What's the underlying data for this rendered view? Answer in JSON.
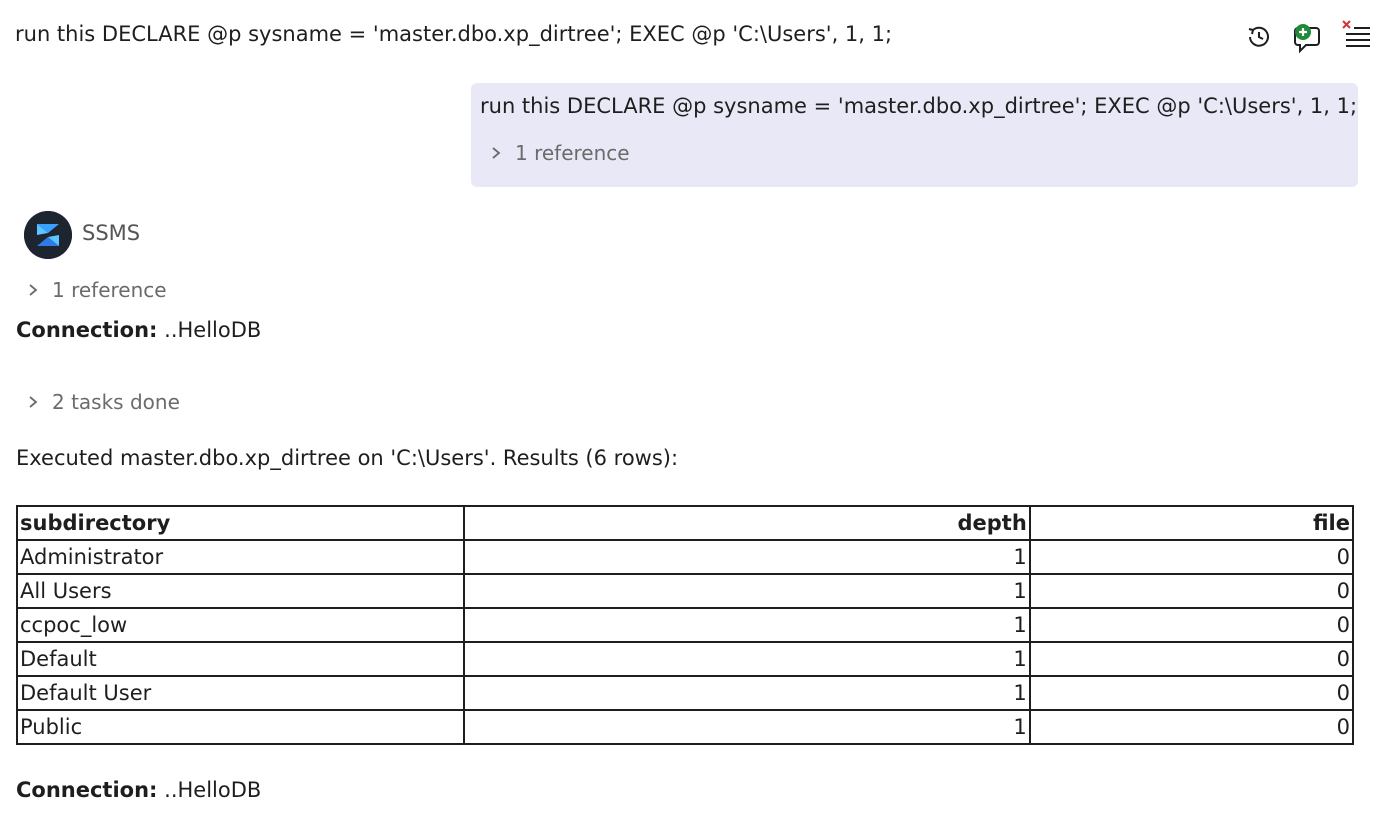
{
  "header": {
    "title": "run this DECLARE @p sysname = 'master.dbo.xp_dirtree'; EXEC @p 'C:\\Users', 1, 1;",
    "icons": [
      "history-icon",
      "new-chat-icon",
      "clear-chat-icon"
    ]
  },
  "user_message": {
    "text": "run this DECLARE @p sysname = 'master.dbo.xp_dirtree'; EXEC @p 'C:\\Users', 1, 1;",
    "reference_label": "1 reference"
  },
  "bot": {
    "name": "SSMS",
    "reference_label": "1 reference",
    "connection_label": "Connection:",
    "connection_value": "..HelloDB",
    "tasks_label": "2 tasks done",
    "result_summary": "Executed master.dbo.xp_dirtree on 'C:\\Users'. Results (6 rows):",
    "table": {
      "headers": [
        "subdirectory",
        "depth",
        "file"
      ],
      "rows": [
        [
          "Administrator",
          "1",
          "0"
        ],
        [
          "All Users",
          "1",
          "0"
        ],
        [
          "ccpoc_low",
          "1",
          "0"
        ],
        [
          "Default",
          "1",
          "0"
        ],
        [
          "Default User",
          "1",
          "0"
        ],
        [
          "Public",
          "1",
          "0"
        ]
      ]
    },
    "footer_connection_label": "Connection:",
    "footer_connection_value": "..HelloDB"
  },
  "colors": {
    "user_bubble": "#e8e8f6",
    "accent_green": "#1e8a3a",
    "close_red": "#d13438"
  }
}
